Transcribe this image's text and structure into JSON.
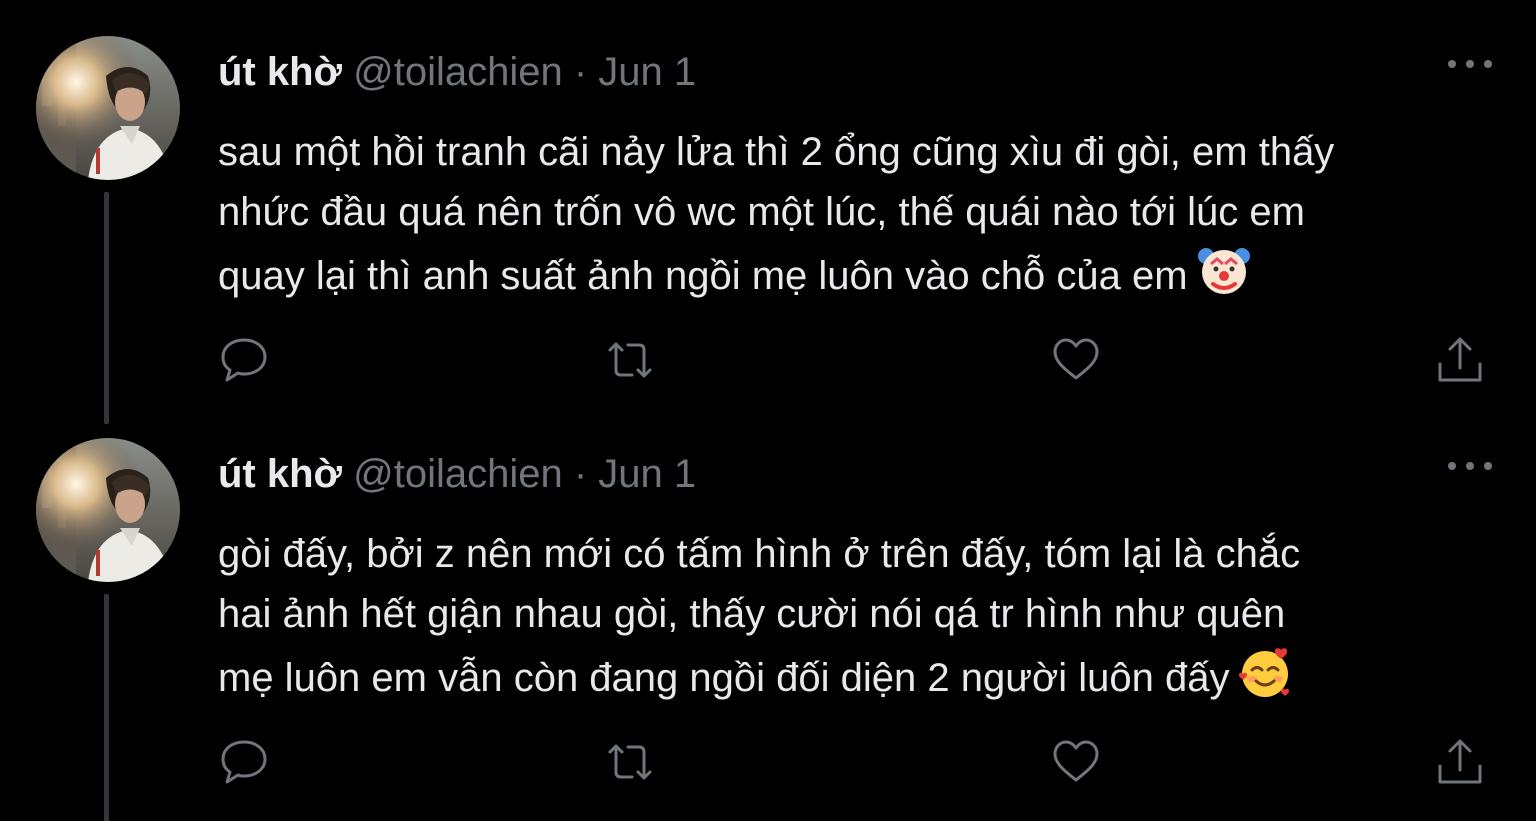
{
  "colors": {
    "background": "#000000",
    "text": "#e7e9ea",
    "secondary": "#71767b",
    "thread_line": "#333639"
  },
  "tweets": [
    {
      "display_name": "út khờ",
      "handle": "@toilachien",
      "separator": "·",
      "date": "Jun 1",
      "text": "sau một hồi tranh cãi nảy lửa thì 2 ổng cũng xìu đi gòi, em thấy\nnhức đầu quá nên trốn vô wc một lúc, thế quái nào tới lúc em\nquay lại thì anh suất ảnh ngồi mẹ luôn vào chỗ của em",
      "emoji": "clown-face-icon",
      "icons": [
        "reply-icon",
        "retweet-icon",
        "like-icon",
        "share-icon",
        "more-icon"
      ]
    },
    {
      "display_name": "út khờ",
      "handle": "@toilachien",
      "separator": "·",
      "date": "Jun 1",
      "text": "gòi đấy, bởi z nên mới có tấm hình ở trên đấy, tóm lại là chắc\nhai ảnh hết giận nhau gòi, thấy cười nói qá tr hình như quên\nmẹ luôn em vẫn còn đang ngồi đối diện 2 người luôn đấy",
      "emoji": "smiling-face-with-hearts-icon",
      "icons": [
        "reply-icon",
        "retweet-icon",
        "like-icon",
        "share-icon",
        "more-icon"
      ]
    }
  ]
}
